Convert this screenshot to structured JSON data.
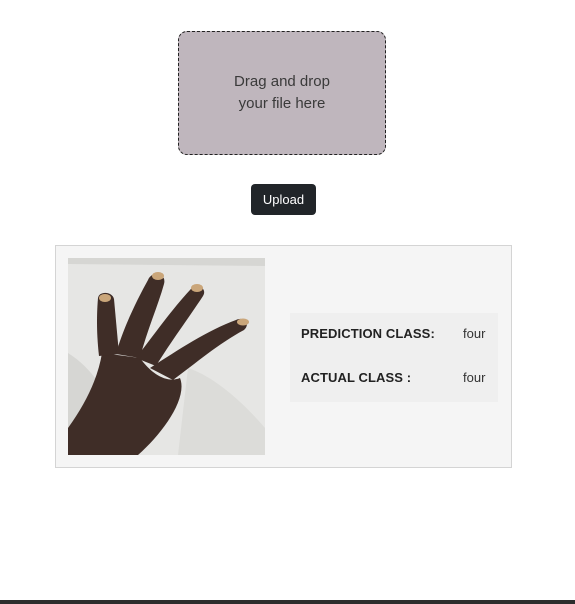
{
  "upload": {
    "dropzone_line1": "Drag and drop",
    "dropzone_line2": "your file here",
    "button_label": "Upload"
  },
  "result": {
    "image_subject": "open hand with four fingers extended",
    "prediction_label": "PREDICTION CLASS:",
    "prediction_value": "four",
    "actual_label": "ACTUAL CLASS :",
    "actual_value": "four"
  },
  "colors": {
    "dropzone_bg": "#bfb6bd",
    "button_bg": "#212529",
    "card_bg": "#f5f5f5",
    "footer_bar": "#2d2d2d"
  }
}
